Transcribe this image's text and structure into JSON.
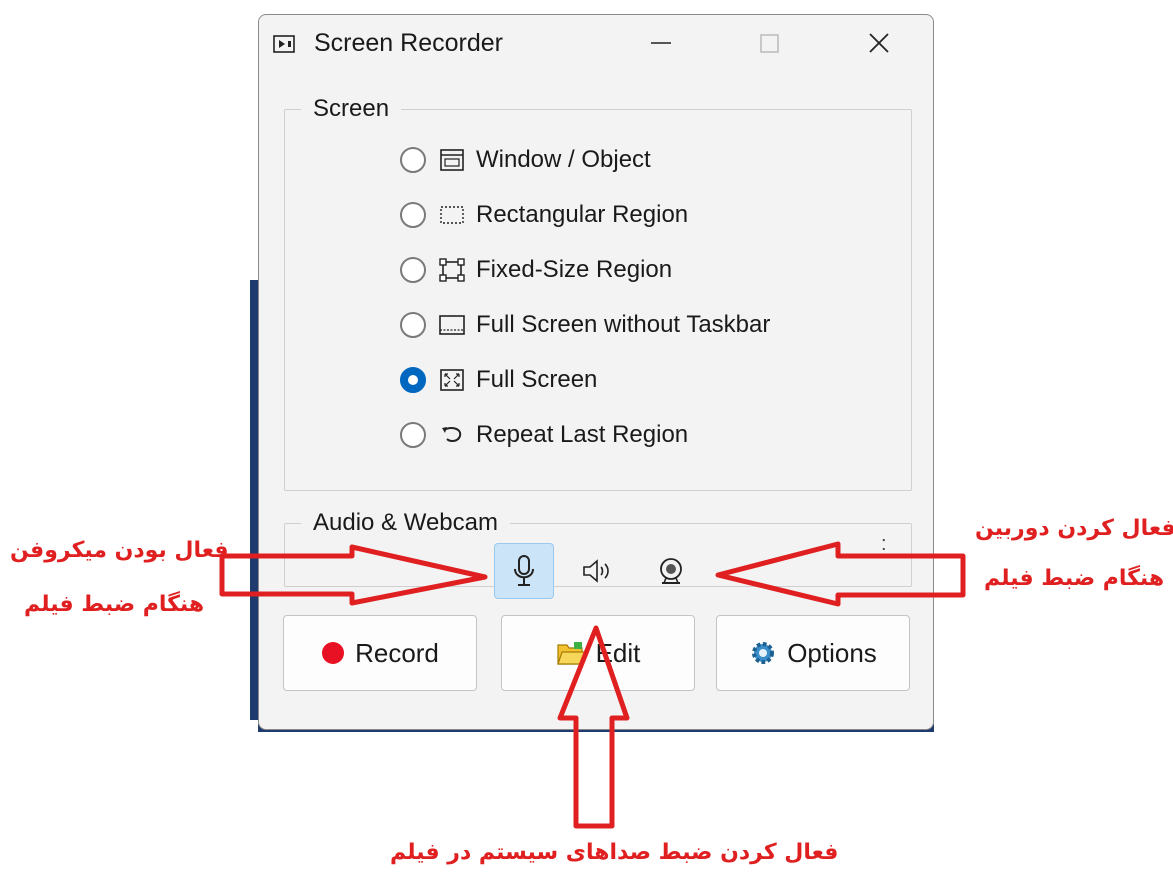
{
  "window": {
    "title": "Screen Recorder",
    "icon": "screen-recorder-icon",
    "controls": [
      "minimize-icon",
      "maximize-icon",
      "close-icon"
    ]
  },
  "screen_group": {
    "legend": "Screen",
    "options": [
      {
        "label": "Window / Object",
        "icon": "window-icon",
        "selected": false
      },
      {
        "label": "Rectangular Region",
        "icon": "dashed-rect-icon",
        "selected": false
      },
      {
        "label": "Fixed-Size Region",
        "icon": "fixed-rect-icon",
        "selected": false
      },
      {
        "label": "Full Screen without Taskbar",
        "icon": "screen-no-taskbar-icon",
        "selected": false
      },
      {
        "label": "Full Screen",
        "icon": "fullscreen-icon",
        "selected": true
      },
      {
        "label": "Repeat Last Region",
        "icon": "repeat-arrow-icon",
        "selected": false
      }
    ]
  },
  "audio_group": {
    "legend": "Audio & Webcam",
    "buttons": [
      {
        "icon": "microphone-icon",
        "active": true
      },
      {
        "icon": "speaker-icon",
        "active": false
      },
      {
        "icon": "webcam-icon",
        "active": false
      }
    ],
    "more": ":"
  },
  "buttons": {
    "record": "Record",
    "edit": "Edit",
    "options": "Options"
  },
  "colors": {
    "annotation": "#e02020",
    "accent": "#0067c0",
    "record_dot": "#e81123",
    "active_button": "#cce4f7"
  },
  "annotations": {
    "mic_line1": "فعال بودن میکروفن",
    "mic_line2": "هنگام ضبط فیلم",
    "cam_line1": "فعال کردن دوربین",
    "cam_line2": "هنگام ضبط فیلم",
    "system_audio": "فعال کردن ضبط صداهای سیستم در فیلم"
  }
}
